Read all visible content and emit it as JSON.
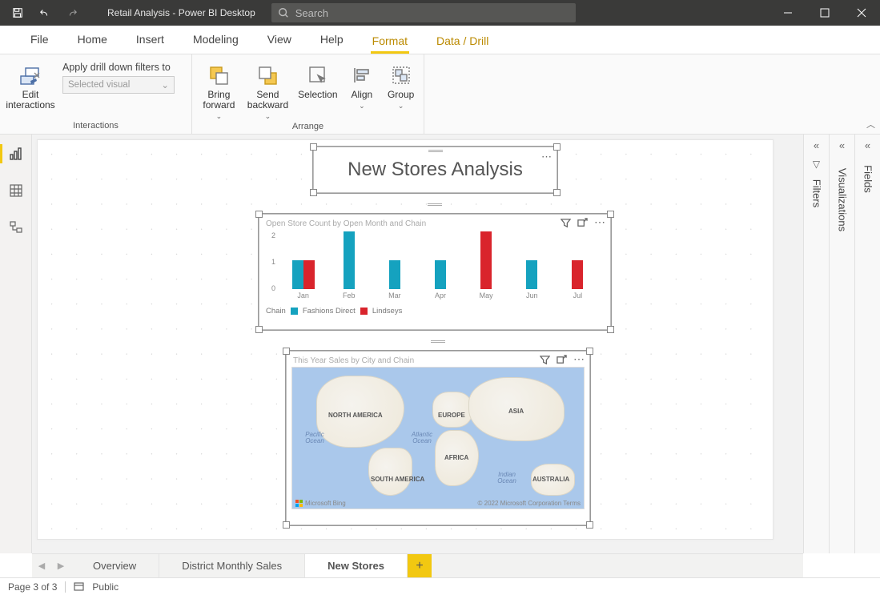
{
  "titlebar": {
    "title": "Retail Analysis - Power BI Desktop",
    "search_placeholder": "Search"
  },
  "menu": {
    "file": "File",
    "home": "Home",
    "insert": "Insert",
    "modeling": "Modeling",
    "view": "View",
    "help": "Help",
    "format": "Format",
    "datadrill": "Data / Drill"
  },
  "ribbon": {
    "interactions_group": "Interactions",
    "arrange_group": "Arrange",
    "edit_interactions": "Edit interactions",
    "drill_label": "Apply drill down filters to",
    "drill_value": "Selected visual",
    "bring_forward": "Bring forward",
    "send_backward": "Send backward",
    "selection": "Selection",
    "align": "Align",
    "group": "Group"
  },
  "panes": {
    "filters": "Filters",
    "visualizations": "Visualizations",
    "fields": "Fields"
  },
  "canvas": {
    "title_visual": "New Stores Analysis",
    "chart_title": "Open Store Count by Open Month and Chain",
    "legend_label": "Chain",
    "legend_fd": "Fashions Direct",
    "legend_li": "Lindseys",
    "map_title": "This Year Sales by City and Chain",
    "map_credit": "Microsoft Bing",
    "map_terms": "© 2022 Microsoft Corporation  Terms",
    "map_labels": {
      "na": "NORTH AMERICA",
      "sa": "SOUTH AMERICA",
      "eu": "EUROPE",
      "af": "AFRICA",
      "as": "ASIA",
      "au": "AUSTRALIA",
      "pac": "Pacific Ocean",
      "atl": "Atlantic Ocean",
      "ind": "Indian Ocean"
    }
  },
  "chart_data": {
    "type": "bar",
    "categories": [
      "Jan",
      "Feb",
      "Mar",
      "Apr",
      "May",
      "Jun",
      "Jul"
    ],
    "series": [
      {
        "name": "Fashions Direct",
        "color": "#15a2bf",
        "values": [
          1,
          2,
          1,
          1,
          0,
          1,
          0
        ]
      },
      {
        "name": "Lindseys",
        "color": "#d9242c",
        "values": [
          1,
          0,
          0,
          0,
          2,
          0,
          1
        ]
      }
    ],
    "ylabel": "",
    "xlabel": "",
    "ylim": [
      0,
      2
    ],
    "yticks": [
      0,
      1,
      2
    ],
    "title": "Open Store Count by Open Month and Chain"
  },
  "tabs": {
    "overview": "Overview",
    "district": "District Monthly Sales",
    "newstores": "New Stores"
  },
  "status": {
    "page": "Page 3 of 3",
    "public": "Public"
  },
  "glyphs": {
    "chev": "«",
    "funnel": "⌕"
  }
}
